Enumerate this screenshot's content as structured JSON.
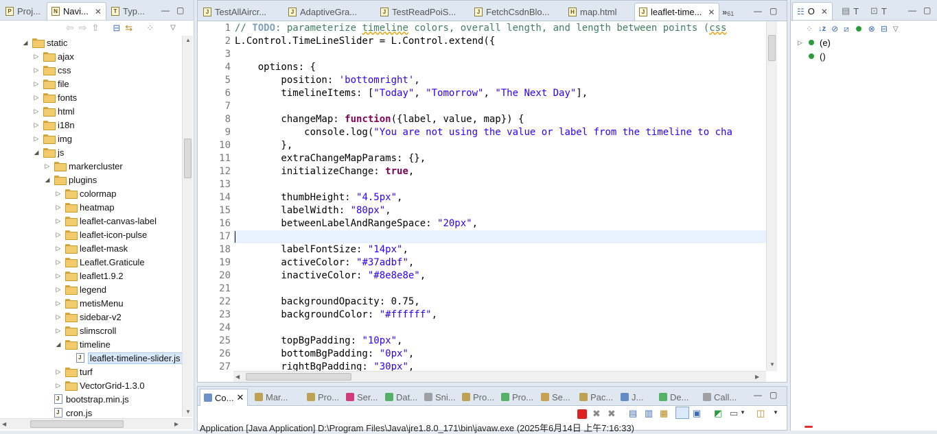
{
  "left_panel": {
    "tabs": [
      {
        "label": "Proj..."
      },
      {
        "label": "Navi...",
        "active": true
      },
      {
        "label": "Typ..."
      }
    ],
    "tree": [
      {
        "label": "static",
        "indent": 0,
        "expanded": true,
        "type": "folder"
      },
      {
        "label": "ajax",
        "indent": 1,
        "expanded": false,
        "type": "folder"
      },
      {
        "label": "css",
        "indent": 1,
        "expanded": false,
        "type": "folder"
      },
      {
        "label": "file",
        "indent": 1,
        "expanded": false,
        "type": "folder"
      },
      {
        "label": "fonts",
        "indent": 1,
        "expanded": false,
        "type": "folder"
      },
      {
        "label": "html",
        "indent": 1,
        "expanded": false,
        "type": "folder"
      },
      {
        "label": "i18n",
        "indent": 1,
        "expanded": false,
        "type": "folder"
      },
      {
        "label": "img",
        "indent": 1,
        "expanded": false,
        "type": "folder"
      },
      {
        "label": "js",
        "indent": 1,
        "expanded": true,
        "type": "folder"
      },
      {
        "label": "markercluster",
        "indent": 2,
        "expanded": false,
        "type": "folder"
      },
      {
        "label": "plugins",
        "indent": 2,
        "expanded": true,
        "type": "folder"
      },
      {
        "label": "colormap",
        "indent": 3,
        "expanded": false,
        "type": "folder"
      },
      {
        "label": "heatmap",
        "indent": 3,
        "expanded": false,
        "type": "folder"
      },
      {
        "label": "leaflet-canvas-label",
        "indent": 3,
        "expanded": false,
        "type": "folder"
      },
      {
        "label": "leaflet-icon-pulse",
        "indent": 3,
        "expanded": false,
        "type": "folder"
      },
      {
        "label": "leaflet-mask",
        "indent": 3,
        "expanded": false,
        "type": "folder"
      },
      {
        "label": "Leaflet.Graticule",
        "indent": 3,
        "expanded": false,
        "type": "folder"
      },
      {
        "label": "leaflet1.9.2",
        "indent": 3,
        "expanded": false,
        "type": "folder"
      },
      {
        "label": "legend",
        "indent": 3,
        "expanded": false,
        "type": "folder"
      },
      {
        "label": "metisMenu",
        "indent": 3,
        "expanded": false,
        "type": "folder"
      },
      {
        "label": "sidebar-v2",
        "indent": 3,
        "expanded": false,
        "type": "folder"
      },
      {
        "label": "slimscroll",
        "indent": 3,
        "expanded": false,
        "type": "folder"
      },
      {
        "label": "timeline",
        "indent": 3,
        "expanded": true,
        "type": "folder"
      },
      {
        "label": "leaflet-timeline-slider.js",
        "indent": 4,
        "type": "file",
        "selected": true
      },
      {
        "label": "turf",
        "indent": 3,
        "expanded": false,
        "type": "folder"
      },
      {
        "label": "VectorGrid-1.3.0",
        "indent": 3,
        "expanded": false,
        "type": "folder"
      },
      {
        "label": "bootstrap.min.js",
        "indent": 2,
        "type": "file"
      },
      {
        "label": "cron.js",
        "indent": 2,
        "type": "file"
      }
    ]
  },
  "editor": {
    "tabs": [
      {
        "label": "TestAllAircr..."
      },
      {
        "label": "AdaptiveGra..."
      },
      {
        "label": "TestReadPoiS..."
      },
      {
        "label": "FetchCsdnBlo..."
      },
      {
        "label": "map.html"
      },
      {
        "label": "leaflet-time...",
        "active": true
      }
    ],
    "overflow_label": "»",
    "overflow_count": "61",
    "current_line": 17,
    "lines": [
      {
        "n": "1",
        "parts": [
          {
            "t": "// ",
            "c": "com"
          },
          {
            "t": "TODO",
            "c": "todo"
          },
          {
            "t": ": parameterize ",
            "c": "com"
          },
          {
            "t": "timeline",
            "c": "com squig"
          },
          {
            "t": " colors, overall length, and length between points (",
            "c": "com"
          },
          {
            "t": "css",
            "c": "com squig"
          }
        ]
      },
      {
        "n": "2",
        "parts": [
          {
            "t": "L.Control.TimeLineSlider = L.Control.extend({",
            "c": ""
          }
        ]
      },
      {
        "n": "3",
        "parts": []
      },
      {
        "n": "4",
        "parts": [
          {
            "t": "    options: {",
            "c": ""
          }
        ]
      },
      {
        "n": "5",
        "parts": [
          {
            "t": "        position: ",
            "c": ""
          },
          {
            "t": "'bottomright'",
            "c": "str"
          },
          {
            "t": ",",
            "c": ""
          }
        ]
      },
      {
        "n": "6",
        "parts": [
          {
            "t": "        timelineItems: [",
            "c": ""
          },
          {
            "t": "\"Today\"",
            "c": "str"
          },
          {
            "t": ", ",
            "c": ""
          },
          {
            "t": "\"Tomorrow\"",
            "c": "str"
          },
          {
            "t": ", ",
            "c": ""
          },
          {
            "t": "\"The Next Day\"",
            "c": "str"
          },
          {
            "t": "],",
            "c": ""
          }
        ]
      },
      {
        "n": "7",
        "parts": []
      },
      {
        "n": "8",
        "parts": [
          {
            "t": "        changeMap: ",
            "c": ""
          },
          {
            "t": "function",
            "c": "kw"
          },
          {
            "t": "({label, value, map}) {",
            "c": ""
          }
        ]
      },
      {
        "n": "9",
        "parts": [
          {
            "t": "            console.log(",
            "c": ""
          },
          {
            "t": "\"You are not using the value or label from the timeline to cha",
            "c": "str"
          }
        ]
      },
      {
        "n": "10",
        "parts": [
          {
            "t": "        },",
            "c": ""
          }
        ]
      },
      {
        "n": "11",
        "parts": [
          {
            "t": "        extraChangeMapParams: {},",
            "c": ""
          }
        ]
      },
      {
        "n": "12",
        "parts": [
          {
            "t": "        initializeChange: ",
            "c": ""
          },
          {
            "t": "true",
            "c": "kw"
          },
          {
            "t": ",",
            "c": ""
          }
        ]
      },
      {
        "n": "13",
        "parts": []
      },
      {
        "n": "14",
        "parts": [
          {
            "t": "        thumbHeight: ",
            "c": ""
          },
          {
            "t": "\"4.5px\"",
            "c": "str"
          },
          {
            "t": ",",
            "c": ""
          }
        ]
      },
      {
        "n": "15",
        "parts": [
          {
            "t": "        labelWidth: ",
            "c": ""
          },
          {
            "t": "\"80px\"",
            "c": "str"
          },
          {
            "t": ",",
            "c": ""
          }
        ]
      },
      {
        "n": "16",
        "parts": [
          {
            "t": "        betweenLabelAndRangeSpace: ",
            "c": ""
          },
          {
            "t": "\"20px\"",
            "c": "str"
          },
          {
            "t": ",",
            "c": ""
          }
        ]
      },
      {
        "n": "17",
        "parts": []
      },
      {
        "n": "18",
        "parts": [
          {
            "t": "        labelFontSize: ",
            "c": ""
          },
          {
            "t": "\"14px\"",
            "c": "str"
          },
          {
            "t": ",",
            "c": ""
          }
        ]
      },
      {
        "n": "19",
        "parts": [
          {
            "t": "        activeColor: ",
            "c": ""
          },
          {
            "t": "\"#37adbf\"",
            "c": "str"
          },
          {
            "t": ",",
            "c": ""
          }
        ]
      },
      {
        "n": "20",
        "parts": [
          {
            "t": "        inactiveColor: ",
            "c": ""
          },
          {
            "t": "\"#8e8e8e\"",
            "c": "str"
          },
          {
            "t": ",",
            "c": ""
          }
        ]
      },
      {
        "n": "21",
        "parts": []
      },
      {
        "n": "22",
        "parts": [
          {
            "t": "        backgroundOpacity: 0.75,",
            "c": ""
          }
        ]
      },
      {
        "n": "23",
        "parts": [
          {
            "t": "        backgroundColor: ",
            "c": ""
          },
          {
            "t": "\"#ffffff\"",
            "c": "str"
          },
          {
            "t": ",",
            "c": ""
          }
        ]
      },
      {
        "n": "24",
        "parts": []
      },
      {
        "n": "25",
        "parts": [
          {
            "t": "        topBgPadding: ",
            "c": ""
          },
          {
            "t": "\"10px\"",
            "c": "str"
          },
          {
            "t": ",",
            "c": ""
          }
        ]
      },
      {
        "n": "26",
        "parts": [
          {
            "t": "        bottomBgPadding: ",
            "c": ""
          },
          {
            "t": "\"0px\"",
            "c": "str"
          },
          {
            "t": ",",
            "c": ""
          }
        ]
      },
      {
        "n": "27",
        "parts": [
          {
            "t": "        rightBgPadding: ",
            "c": ""
          },
          {
            "t": "\"30px\"",
            "c": "str"
          },
          {
            "t": ",",
            "c": ""
          }
        ]
      }
    ]
  },
  "outline": {
    "tabs": [
      {
        "label": "O",
        "active": true
      },
      {
        "label": "T"
      },
      {
        "label": "T"
      }
    ],
    "items": [
      {
        "label": "(e)",
        "has_children": true
      },
      {
        "label": "()",
        "has_children": false
      }
    ]
  },
  "console": {
    "tabs": [
      {
        "label": "Co...",
        "active": true
      },
      {
        "label": "Mar..."
      },
      {
        "label": "Pro..."
      },
      {
        "label": "Ser..."
      },
      {
        "label": "Dat..."
      },
      {
        "label": "Sni..."
      },
      {
        "label": "Pro..."
      },
      {
        "label": "Pro..."
      },
      {
        "label": "Se..."
      },
      {
        "label": "Pac..."
      },
      {
        "label": "J..."
      },
      {
        "label": "De..."
      },
      {
        "label": "Call..."
      }
    ],
    "status_text": "Application [Java Application] D:\\Program Files\\Java\\jre1.8.0_171\\bin\\javaw.exe (2025年6月14日 上午7:16:33)"
  },
  "colors": {
    "keyword": "#7f0055",
    "string": "#2a00ff",
    "comment": "#3f7f5f",
    "current_line": "#e8f2fe",
    "tree_selection": "#d9e8f8"
  }
}
